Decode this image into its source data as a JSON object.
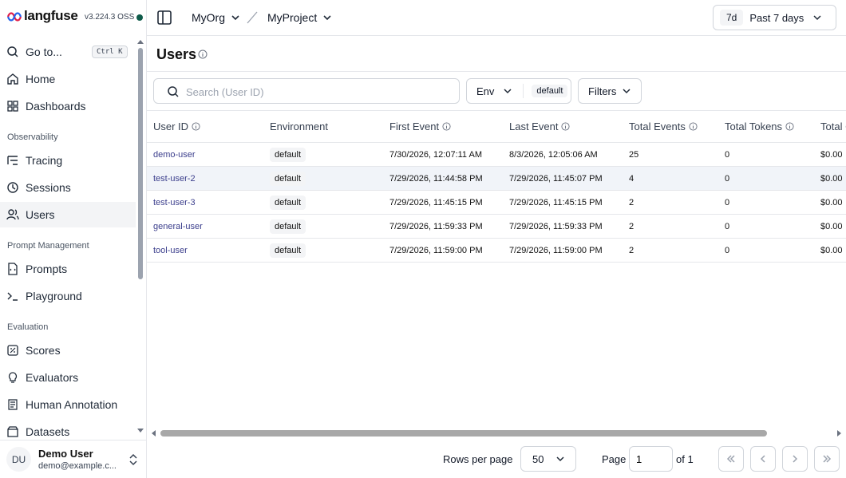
{
  "brand": {
    "name": "langfuse",
    "version": "v3.224.3 OSS"
  },
  "nav": {
    "goto_label": "Go to...",
    "goto_shortcut": "Ctrl K",
    "home": "Home",
    "dashboards": "Dashboards",
    "section_observability": "Observability",
    "tracing": "Tracing",
    "sessions": "Sessions",
    "users": "Users",
    "section_prompt": "Prompt Management",
    "prompts": "Prompts",
    "playground": "Playground",
    "section_evaluation": "Evaluation",
    "scores": "Scores",
    "evaluators": "Evaluators",
    "human_annotation": "Human Annotation",
    "datasets": "Datasets"
  },
  "user": {
    "initials": "DU",
    "name": "Demo User",
    "email": "demo@example.c..."
  },
  "topbar": {
    "org": "MyOrg",
    "project": "MyProject",
    "date_short": "7d",
    "date_label": "Past 7 days"
  },
  "page": {
    "title": "Users"
  },
  "toolbar": {
    "search_placeholder": "Search (User ID)",
    "env_label": "Env",
    "env_value": "default",
    "filters_label": "Filters"
  },
  "table": {
    "headers": [
      "User ID",
      "Environment",
      "First Event",
      "Last Event",
      "Total Events",
      "Total Tokens",
      "Total Cost"
    ],
    "rows": [
      {
        "user_id": "demo-user",
        "environment": "default",
        "first_event": "7/30/2026, 12:07:11 AM",
        "last_event": "8/3/2026, 12:05:06 AM",
        "total_events": "25",
        "total_tokens": "0",
        "total_cost": "$0.00"
      },
      {
        "user_id": "test-user-2",
        "environment": "default",
        "first_event": "7/29/2026, 11:44:58 PM",
        "last_event": "7/29/2026, 11:45:07 PM",
        "total_events": "4",
        "total_tokens": "0",
        "total_cost": "$0.00"
      },
      {
        "user_id": "test-user-3",
        "environment": "default",
        "first_event": "7/29/2026, 11:45:15 PM",
        "last_event": "7/29/2026, 11:45:15 PM",
        "total_events": "2",
        "total_tokens": "0",
        "total_cost": "$0.00"
      },
      {
        "user_id": "general-user",
        "environment": "default",
        "first_event": "7/29/2026, 11:59:33 PM",
        "last_event": "7/29/2026, 11:59:33 PM",
        "total_events": "2",
        "total_tokens": "0",
        "total_cost": "$0.00"
      },
      {
        "user_id": "tool-user",
        "environment": "default",
        "first_event": "7/29/2026, 11:59:00 PM",
        "last_event": "7/29/2026, 11:59:00 PM",
        "total_events": "2",
        "total_tokens": "0",
        "total_cost": "$0.00"
      }
    ]
  },
  "pagination": {
    "rows_per_page_label": "Rows per page",
    "rows_per_page": "50",
    "page_label": "Page",
    "page_value": "1",
    "of_label": "of 1"
  }
}
